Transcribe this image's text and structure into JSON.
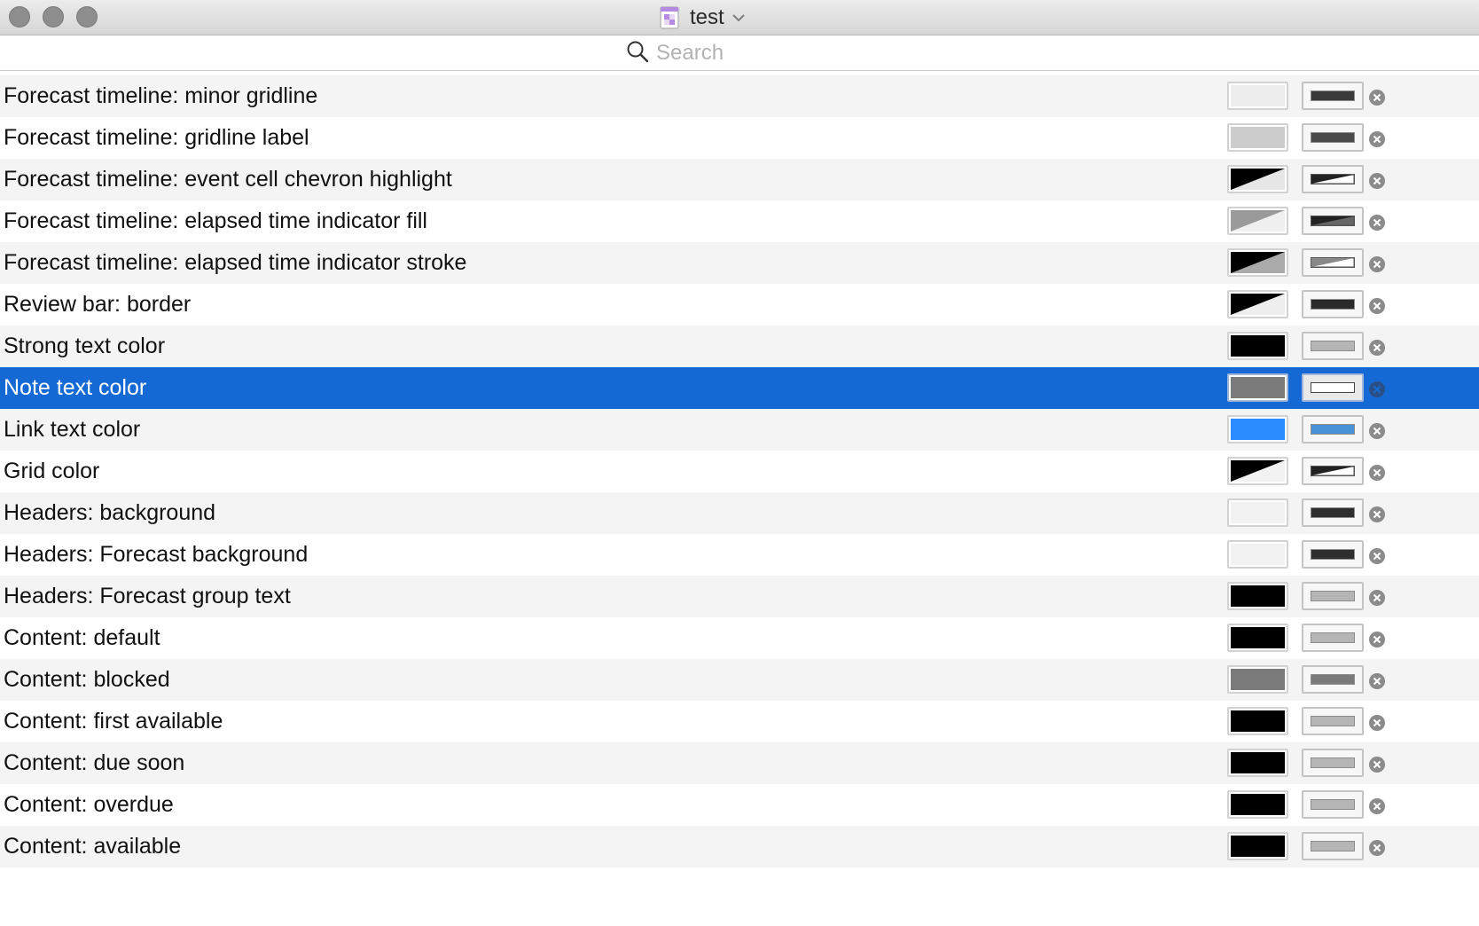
{
  "window": {
    "title": "test"
  },
  "search": {
    "placeholder": "Search",
    "value": ""
  },
  "rows": [
    {
      "label": "Forecast timeline: minor gridline",
      "swatch": {
        "kind": "solid",
        "color": "#ededed"
      },
      "well": {
        "kind": "solid",
        "color": "#3a3a3a"
      }
    },
    {
      "label": "Forecast timeline: gridline label",
      "swatch": {
        "kind": "solid",
        "color": "#cccccc"
      },
      "well": {
        "kind": "solid",
        "color": "#4a4a4a"
      }
    },
    {
      "label": "Forecast timeline: event cell chevron highlight",
      "swatch": {
        "kind": "split",
        "color": "#000000",
        "alt": "#e6e6e6"
      },
      "well": {
        "kind": "split",
        "color": "#222222",
        "alt": "#ffffff"
      }
    },
    {
      "label": "Forecast timeline: elapsed time indicator fill",
      "swatch": {
        "kind": "split",
        "color": "#9a9a9a",
        "alt": "#f0f0f0"
      },
      "well": {
        "kind": "split",
        "color": "#222222",
        "alt": "#666666"
      }
    },
    {
      "label": "Forecast timeline: elapsed time indicator stroke",
      "swatch": {
        "kind": "split",
        "color": "#000000",
        "alt": "#aaaaaa"
      },
      "well": {
        "kind": "split",
        "color": "#888888",
        "alt": "#ffffff"
      }
    },
    {
      "label": "Review bar: border",
      "swatch": {
        "kind": "split",
        "color": "#000000",
        "alt": "#eeeeee"
      },
      "well": {
        "kind": "solid",
        "color": "#2a2a2a"
      }
    },
    {
      "label": "Strong text color",
      "swatch": {
        "kind": "solid",
        "color": "#000000"
      },
      "well": {
        "kind": "solid",
        "color": "#b5b5b5"
      }
    },
    {
      "label": "Note text color",
      "swatch": {
        "kind": "solid",
        "color": "#7a7a7a"
      },
      "well": {
        "kind": "solid",
        "color": "#ffffff"
      },
      "selected": true
    },
    {
      "label": "Link text color",
      "swatch": {
        "kind": "solid",
        "color": "#2b8cff"
      },
      "well": {
        "kind": "solid",
        "color": "#4a92d8"
      }
    },
    {
      "label": "Grid color",
      "swatch": {
        "kind": "split",
        "color": "#000000",
        "alt": "#f2f2f2"
      },
      "well": {
        "kind": "split",
        "color": "#222222",
        "alt": "#ffffff"
      }
    },
    {
      "label": "Headers: background",
      "swatch": {
        "kind": "solid",
        "color": "#f2f2f2"
      },
      "well": {
        "kind": "solid",
        "color": "#2e2e2e"
      }
    },
    {
      "label": "Headers: Forecast background",
      "swatch": {
        "kind": "solid",
        "color": "#f2f2f2"
      },
      "well": {
        "kind": "solid",
        "color": "#2e2e2e"
      }
    },
    {
      "label": "Headers: Forecast group text",
      "swatch": {
        "kind": "solid",
        "color": "#000000"
      },
      "well": {
        "kind": "solid",
        "color": "#b5b5b5"
      }
    },
    {
      "label": "Content: default",
      "swatch": {
        "kind": "solid",
        "color": "#000000"
      },
      "well": {
        "kind": "solid",
        "color": "#b5b5b5"
      }
    },
    {
      "label": "Content: blocked",
      "swatch": {
        "kind": "solid",
        "color": "#7a7a7a"
      },
      "well": {
        "kind": "solid",
        "color": "#7a7a7a"
      }
    },
    {
      "label": "Content: first available",
      "swatch": {
        "kind": "solid",
        "color": "#000000"
      },
      "well": {
        "kind": "solid",
        "color": "#b5b5b5"
      }
    },
    {
      "label": "Content: due soon",
      "swatch": {
        "kind": "solid",
        "color": "#000000"
      },
      "well": {
        "kind": "solid",
        "color": "#b5b5b5"
      }
    },
    {
      "label": "Content: overdue",
      "swatch": {
        "kind": "solid",
        "color": "#000000"
      },
      "well": {
        "kind": "solid",
        "color": "#b5b5b5"
      }
    },
    {
      "label": "Content: available",
      "swatch": {
        "kind": "solid",
        "color": "#000000"
      },
      "well": {
        "kind": "solid",
        "color": "#b5b5b5"
      }
    }
  ],
  "icons": {
    "document": "document-icon",
    "search": "search-icon",
    "clear": "clear-icon",
    "chevron": "chevron-down-icon"
  },
  "colors": {
    "selection": "#1469d4",
    "row_alt": "#f4f4f4"
  }
}
